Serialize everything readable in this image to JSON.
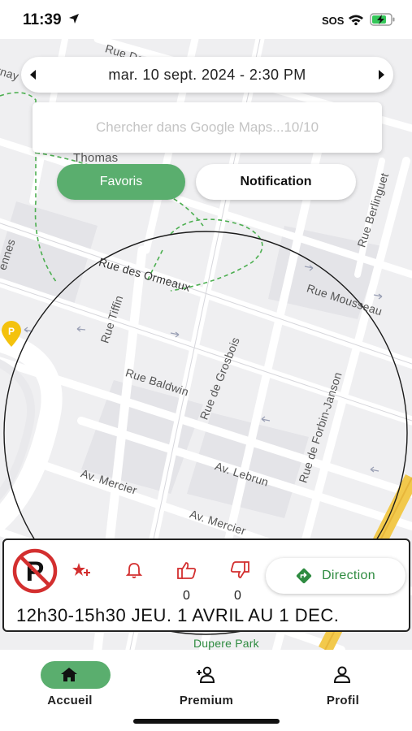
{
  "status_bar": {
    "time": "11:39",
    "sos": "SOS",
    "icons": [
      "location-arrow-icon",
      "wifi-icon",
      "battery-charging-icon"
    ]
  },
  "date_selector": {
    "value": "mar. 10 sept. 2024 - 2:30 PM",
    "prev_icon": "triangle-left-icon",
    "next_icon": "triangle-right-icon"
  },
  "search": {
    "placeholder": "Chercher dans Google Maps...10/10",
    "value": ""
  },
  "filters": {
    "favoris": "Favoris",
    "notification": "Notification",
    "active": "favoris"
  },
  "map": {
    "streets": [
      "Rue Desmarteau",
      "Rue des Ormeaux",
      "Rue Mousseau",
      "Rue Tiffin",
      "Rue Baldwin",
      "Rue de Grosbois",
      "Rue de Forbin-Janson",
      "Av. Lebrun",
      "Av. Mercier",
      "Av. Mercier",
      "Rue Berlinguet",
      "Thomas",
      "Dupere Park",
      "rnay",
      "ennes"
    ],
    "marker_label": "P"
  },
  "info_panel": {
    "no_parking_icon": "no-parking-icon",
    "likes": "0",
    "dislikes": "0",
    "direction_label": "Direction",
    "schedule": "12h30-15h30 JEU. 1 AVRIL AU 1 DEC."
  },
  "nav": {
    "items": [
      {
        "label": "Accueil",
        "icon": "home-icon"
      },
      {
        "label": "Premium",
        "icon": "add-user-icon"
      },
      {
        "label": "Profil",
        "icon": "user-icon"
      }
    ],
    "active": "Accueil"
  },
  "colors": {
    "accent_green": "#5aae6e",
    "direction_green": "#2e8b40",
    "red": "#d32f2f",
    "marker_yellow": "#f4c20d"
  }
}
